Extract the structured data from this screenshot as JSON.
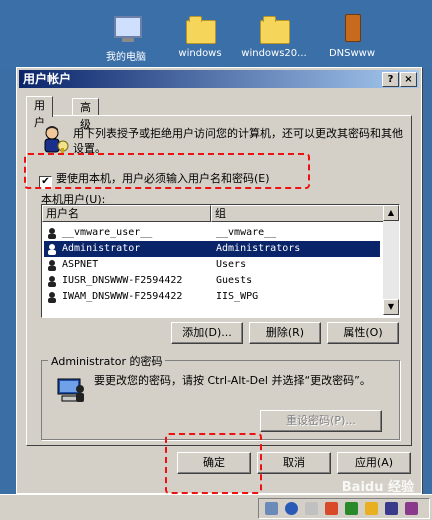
{
  "desktop": {
    "icons": [
      {
        "label": "我的电脑",
        "icon": "my-computer-icon"
      },
      {
        "label": "windows",
        "icon": "folder-icon"
      },
      {
        "label": "windows20...",
        "icon": "folder-icon"
      },
      {
        "label": "DNSwww",
        "icon": "phone-icon"
      }
    ]
  },
  "dialog": {
    "title": "用户帐户",
    "help_button": "?",
    "close_button": "×",
    "tabs": [
      {
        "label": "用户",
        "active": true
      },
      {
        "label": "高级",
        "active": false
      }
    ],
    "info_text": "用下列表授予或拒绝用户访问您的计算机，还可以更改其密码和其他设置。",
    "require_login_checkbox": {
      "label": "要使用本机，用户必须输入用户名和密码(E)",
      "checked": true
    },
    "user_list": {
      "label": "本机用户(U):",
      "columns": [
        "用户名",
        "组"
      ],
      "rows": [
        {
          "name": "__vmware_user__",
          "group": "__vmware__",
          "selected": false
        },
        {
          "name": "Administrator",
          "group": "Administrators",
          "selected": true
        },
        {
          "name": "ASPNET",
          "group": "Users",
          "selected": false
        },
        {
          "name": "IUSR_DNSWWW-F2594422",
          "group": "Guests",
          "selected": false
        },
        {
          "name": "IWAM_DNSWWW-F2594422",
          "group": "IIS_WPG",
          "selected": false
        }
      ]
    },
    "list_buttons": {
      "add": "添加(D)...",
      "remove": "删除(R)",
      "properties": "属性(O)"
    },
    "password_group": {
      "legend": "Administrator 的密码",
      "text": "要更改您的密码，请按 Ctrl-Alt-Del 并选择“更改密码”。",
      "reset_button": "重设密码(P)..."
    },
    "footer_buttons": {
      "ok": "确定",
      "cancel": "取消",
      "apply": "应用(A)"
    }
  },
  "watermark": "Baidu 经验",
  "colors": {
    "titlebar_start": "#0a246a",
    "titlebar_end": "#a6caf0",
    "selection": "#0a246a",
    "dialog_bg": "#d4d0c8",
    "highlight_box": "#e11111"
  }
}
